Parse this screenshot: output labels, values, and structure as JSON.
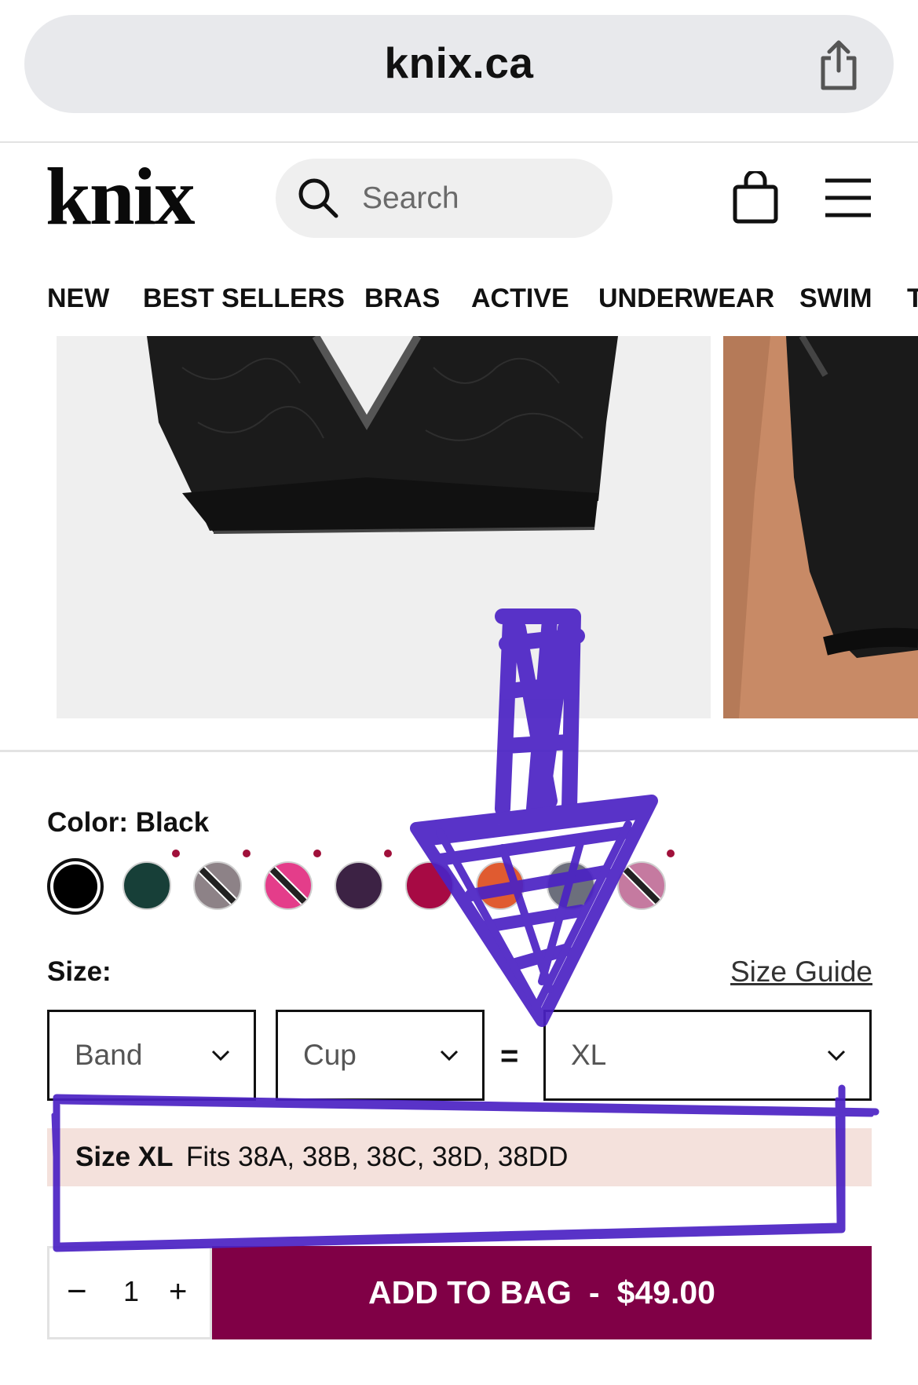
{
  "browser": {
    "url": "knix.ca",
    "share_icon": "share-icon"
  },
  "header": {
    "logo": "knix",
    "search_placeholder": "Search",
    "icons": [
      "search-icon",
      "bag-icon",
      "menu-icon"
    ]
  },
  "nav": {
    "items": [
      "NEW",
      "BEST SELLERS",
      "BRAS",
      "ACTIVE",
      "UNDERWEAR",
      "SWIM",
      "T"
    ]
  },
  "product": {
    "color_label": "Color:",
    "color_value": "Black",
    "swatches": [
      {
        "color": "#000000",
        "selected": true
      },
      {
        "color": "#173f38"
      },
      {
        "color": "#8d8287",
        "slash": true
      },
      {
        "color": "#e43d8a",
        "slash": true
      },
      {
        "color": "#3c2244"
      },
      {
        "color": "#a70a44"
      },
      {
        "color": "#e05b30"
      },
      {
        "color": "#6c6f7c"
      },
      {
        "color": "#c57aa0",
        "slash": true
      }
    ],
    "size_label": "Size:",
    "size_guide": "Size Guide",
    "band_select": "Band",
    "cup_select": "Cup",
    "equals": "=",
    "size_select": "XL",
    "fits_title": "Size XL",
    "fits_text": "Fits 38A, 38B, 38C, 38D, 38DD",
    "quantity": "1",
    "qty_minus": "−",
    "qty_plus": "+",
    "add_to_bag": "ADD TO BAG",
    "price_separator": "-",
    "price": "$49.00"
  },
  "colors": {
    "accent": "#800046",
    "fits_bg": "#f4e1dc",
    "annotation": "#4b22c4"
  }
}
